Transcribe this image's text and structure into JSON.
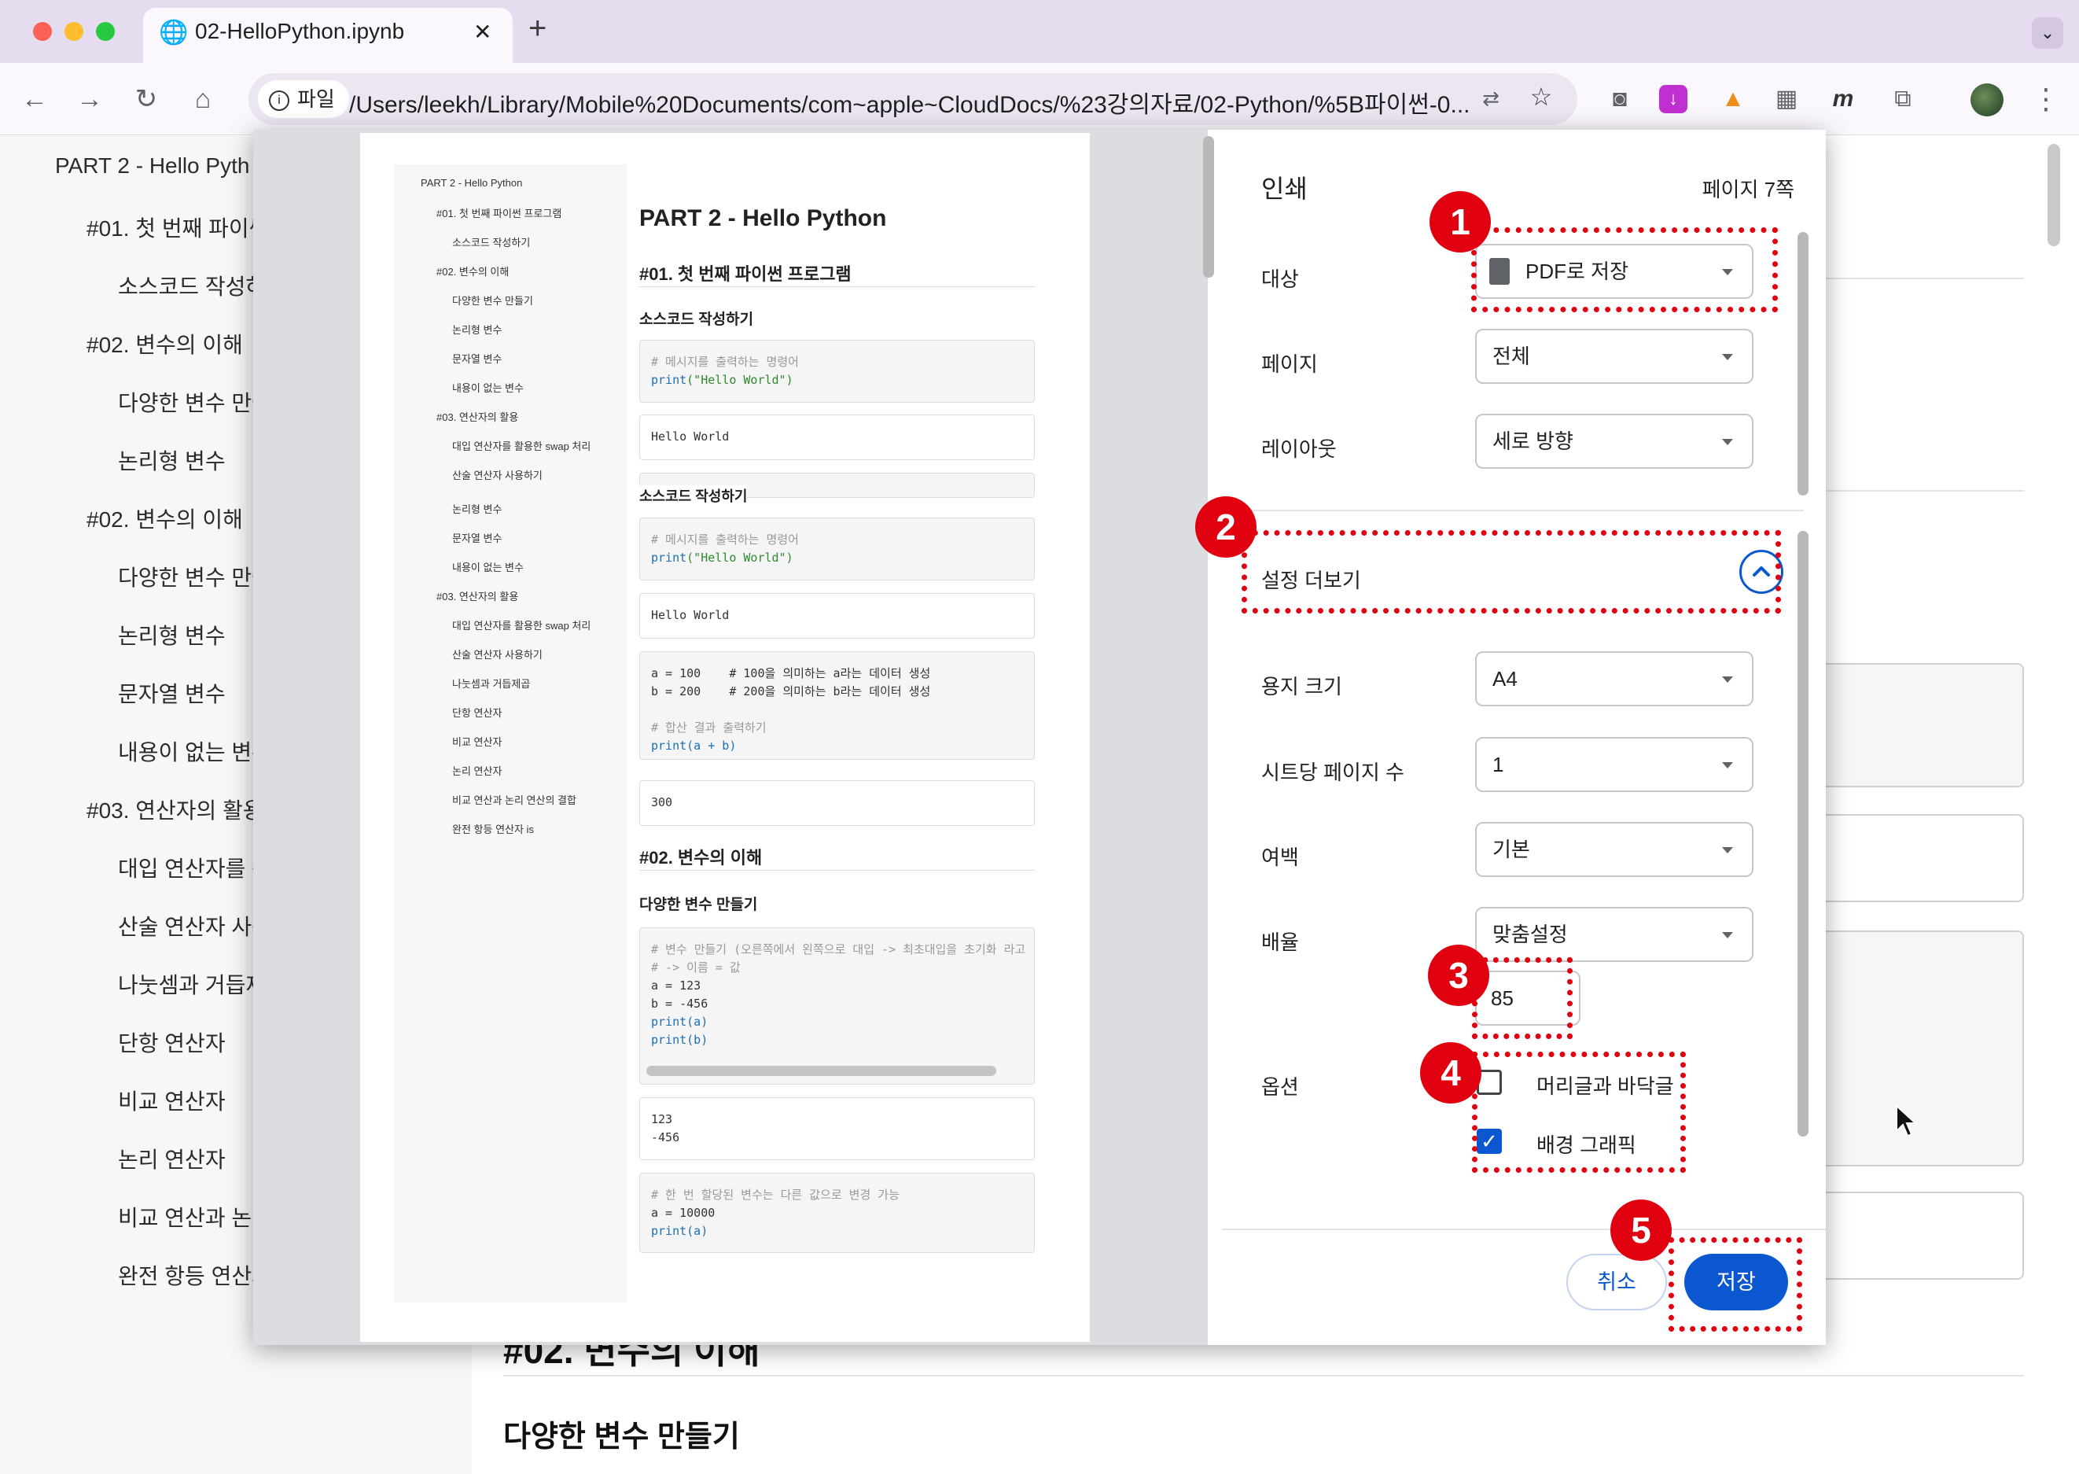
{
  "browser": {
    "tab_title": "02-HelloPython.ipynb",
    "new_tab": "+",
    "tab_close": "✕",
    "url_chip": "파일",
    "url": "/Users/leekh/Library/Mobile%20Documents/com~apple~CloudDocs/%23강의자료/02-Python/%5B파이썬-0..."
  },
  "page": {
    "toc": [
      "PART 2 - Hello Pyth",
      "#01. 첫 번째 파이썬",
      "소스코드 작성하",
      "#02. 변수의 이해",
      "다양한 변수 만들",
      "논리형 변수",
      "#02. 변수의 이해",
      "다양한 변수 만들",
      "논리형 변수",
      "문자열 변수",
      "내용이 없는 변수",
      "#03. 연산자의 활용",
      "대입 연산자를 활",
      "산술 연산자 사용",
      "나눗셈과 거듭제",
      "단항 연산자",
      "비교 연산자",
      "논리 연산자",
      "비교 연산과 논리",
      "완전 항등 연산자"
    ],
    "main_heading": "#02. 변수의 이해",
    "main_subheading": "다양한 변수 만들기"
  },
  "preview": {
    "toc": [
      "PART 2 - Hello Python",
      "#01. 첫 번째 파이썬 프로그램",
      "소스코드 작성하기",
      "#02. 변수의 이해",
      "다양한 변수 만들기",
      "논리형 변수",
      "문자열 변수",
      "내용이 없는 변수",
      "#03. 연산자의 활용",
      "대입 연산자를 활용한 swap 처리",
      "산술 연산자 사용하기",
      "논리형 변수",
      "문자열 변수",
      "내용이 없는 변수",
      "#03. 연산자의 활용",
      "대입 연산자를 활용한 swap 처리",
      "산술 연산자 사용하기",
      "나눗셈과 거듭제곱",
      "단항 연산자",
      "비교 연산자",
      "논리 연산자",
      "비교 연산과 논리 연산의 결합",
      "완전 항등 연산자 is"
    ],
    "title": "PART 2 - Hello Python",
    "h_first_program": "#01. 첫 번째 파이썬 프로그램",
    "h_source": "소스코드 작성하기",
    "code1_comment": "# 메시지를 출력하는 명령어",
    "code1_print": "print",
    "code1_arg": "(\"Hello World\")",
    "out1": "Hello World",
    "overlap_text": "소스코드 작성하기",
    "code2_comment": "# 메시지를 출력하는 명령어",
    "code2_print": "print",
    "code2_arg": "(\"Hello World\")",
    "out2": "Hello World",
    "code3_lines": [
      "a = 100    # 100을 의미하는 a라는 데이터 생성",
      "b = 200    # 200을 의미하는 b라는 데이터 생성",
      "",
      "# 합산 결과 출력하기",
      "print(a + b)"
    ],
    "out3": "300",
    "h_vars": "#02. 변수의 이해",
    "h_make_vars": "다양한 변수 만들기",
    "code4_lines": [
      "# 변수 만들기 (오른쪽에서 왼쪽으로 대입 -> 최초대입을 초기화 라고",
      "# -> 이름 = 값",
      "a = 123",
      "b = -456",
      "print(a)",
      "print(b)"
    ],
    "out4_lines": [
      "123",
      "-456"
    ],
    "code5_lines": [
      "# 한 번 할당된 변수는 다른 값으로 변경 가능",
      "a = 10000",
      "print(a)"
    ]
  },
  "print_settings": {
    "title": "인쇄",
    "page_count": "페이지 7쪽",
    "destination_label": "대상",
    "destination_value": "PDF로 저장",
    "pages_label": "페이지",
    "pages_value": "전체",
    "layout_label": "레이아웃",
    "layout_value": "세로 방향",
    "more_settings_label": "설정 더보기",
    "paper_label": "용지 크기",
    "paper_value": "A4",
    "pages_per_sheet_label": "시트당 페이지 수",
    "pages_per_sheet_value": "1",
    "margins_label": "여백",
    "margins_value": "기본",
    "scale_label": "배율",
    "scale_value": "맞춤설정",
    "scale_number": "85",
    "options_label": "옵션",
    "option_headers_footers": "머리글과 바닥글",
    "option_headers_footers_checked": false,
    "option_background_graphics": "배경 그래픽",
    "option_background_graphics_checked": true,
    "cancel_button": "취소",
    "save_button": "저장"
  },
  "annotations": {
    "badges": [
      "1",
      "2",
      "3",
      "4",
      "5"
    ],
    "color": "#e0000f"
  },
  "colors": {
    "accent": "#0b57d0",
    "tabbar": "#e5dcef"
  }
}
